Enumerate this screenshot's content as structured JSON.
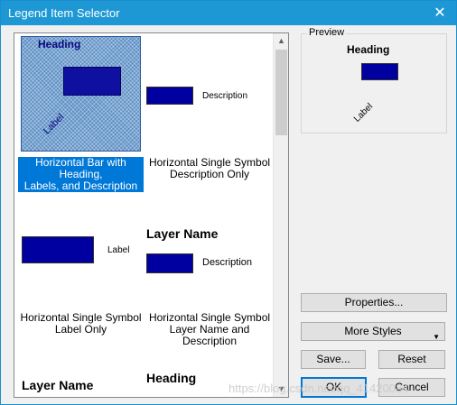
{
  "window": {
    "title": "Legend Item Selector",
    "close_glyph": "✕"
  },
  "gallery": {
    "items": [
      {
        "caption_line1": "Horizontal Bar with Heading,",
        "caption_line2": "Labels, and Description",
        "heading": "Heading",
        "label": "Label",
        "selected": true
      },
      {
        "caption_line1": "Horizontal Single Symbol",
        "caption_line2": "Description Only",
        "description": "Description"
      },
      {
        "caption_line1": "Horizontal Single Symbol",
        "caption_line2": "Label Only",
        "label": "Label"
      },
      {
        "caption_line1": "Horizontal Single Symbol",
        "caption_line2": "Layer Name and Description",
        "layer_name": "Layer Name",
        "description": "Description"
      },
      {
        "layer_name": "Layer Name"
      },
      {
        "heading": "Heading"
      }
    ],
    "scroll_up_glyph": "▲",
    "scroll_down_glyph": "▼"
  },
  "preview": {
    "legend": "Preview",
    "heading": "Heading",
    "label": "Label"
  },
  "buttons": {
    "properties": "Properties...",
    "more_styles": "More Styles",
    "more_styles_arrow": "▼",
    "save": "Save...",
    "reset": "Reset",
    "ok": "OK",
    "cancel": "Cancel"
  },
  "watermark": "https://blog.csdn.net/qq_41420084",
  "colors": {
    "titlebar": "#1e98d4",
    "selection": "#0078d7",
    "swatch": "#0000a0"
  }
}
